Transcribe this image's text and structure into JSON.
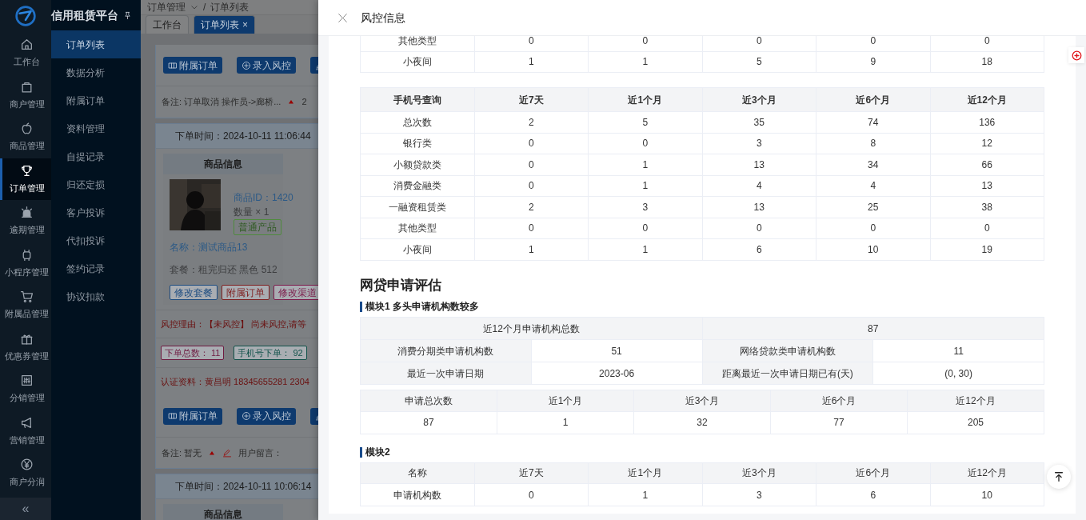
{
  "app": {
    "title": "信用租赁平台"
  },
  "rail": [
    {
      "label": "工作台",
      "selected": false
    },
    {
      "label": "商户管理",
      "selected": false
    },
    {
      "label": "商品管理",
      "selected": false
    },
    {
      "label": "订单管理",
      "selected": true
    },
    {
      "label": "逾期管理",
      "selected": false
    },
    {
      "label": "小程序管理",
      "selected": false
    },
    {
      "label": "附属品管理",
      "selected": false
    },
    {
      "label": "优惠券管理",
      "selected": false
    },
    {
      "label": "分销管理",
      "selected": false
    },
    {
      "label": "营销管理",
      "selected": false
    },
    {
      "label": "商户分润",
      "selected": false
    }
  ],
  "collapse": "«",
  "submenu": [
    {
      "label": "订单列表",
      "selected": true
    },
    {
      "label": "数据分析",
      "selected": false
    },
    {
      "label": "附属订单",
      "selected": false
    },
    {
      "label": "资料管理",
      "selected": false
    },
    {
      "label": "自提记录",
      "selected": false
    },
    {
      "label": "归还定损",
      "selected": false
    },
    {
      "label": "客户投诉",
      "selected": false
    },
    {
      "label": "代扣投诉",
      "selected": false
    },
    {
      "label": "签约记录",
      "selected": false
    },
    {
      "label": "协议扣款",
      "selected": false
    }
  ],
  "breadcrumb": [
    {
      "label": "订单管理",
      "dropdown": true
    },
    {
      "label": "订单列表",
      "dropdown": false
    }
  ],
  "breadcrumb_separator": "/",
  "tabs": [
    {
      "label": "工作台",
      "selected": false
    },
    {
      "label": "订单列表",
      "selected": true,
      "close": "×"
    }
  ],
  "order_list": {
    "top_actions": [
      {
        "kind": "grid",
        "label": "附属订单"
      },
      {
        "kind": "plus",
        "label": "录入风控"
      },
      {
        "kind": "edit"
      }
    ],
    "top_remark": {
      "text": "备注: 订单取消 操作员->廊桥...",
      "extra": "2"
    },
    "order": {
      "time": "下单时间：2024-10-11 11:06:44",
      "section": "商品信息",
      "product_id": "商品ID：1420",
      "quantity": "数量 × 1",
      "tag": "普通产品",
      "name": "名称：测试商品13",
      "package": "套餐：租完归还 黑色 512",
      "product_actions": [
        {
          "label": "修改套餐",
          "color": "#1d4c80"
        },
        {
          "label": "附属订单",
          "color": "#7e1f1f"
        },
        {
          "label": "修改渠道",
          "color": "#7c1a4a"
        }
      ],
      "risk": "风控理由：【未风控】 尚未风控,请等",
      "stats": [
        {
          "label": "下单总数：",
          "value": "11",
          "color": "#6e1a40"
        },
        {
          "label": "手机号下单：",
          "value": "92",
          "color": "#11524a"
        }
      ],
      "auth": "认证资料：黄昌明  18345655281  2304",
      "actions": [
        {
          "kind": "grid",
          "label": "附属订单"
        },
        {
          "kind": "plus",
          "label": "录入风控"
        },
        {
          "kind": "edit"
        }
      ],
      "remark": "备注: 暂无",
      "message_label": "用户留言："
    },
    "next_order": {
      "time": "下单时间：2024-10-11 10:06:14",
      "section": "商品信息"
    }
  },
  "drawer": {
    "title": "风控信息",
    "prev_table": {
      "rows": [
        [
          "其他类型",
          "0",
          "0",
          "0",
          "0",
          "0"
        ],
        [
          "小夜间",
          "1",
          "1",
          "5",
          "9",
          "18"
        ]
      ]
    },
    "phone_table": {
      "columns": [
        "手机号查询",
        "近7天",
        "近1个月",
        "近3个月",
        "近6个月",
        "近12个月"
      ],
      "rows": [
        [
          "总次数",
          "2",
          "5",
          "35",
          "74",
          "136"
        ],
        [
          "银行类",
          "0",
          "0",
          "3",
          "8",
          "12"
        ],
        [
          "小额贷款类",
          "0",
          "1",
          "13",
          "34",
          "66"
        ],
        [
          "消费金融类",
          "0",
          "1",
          "4",
          "4",
          "13"
        ],
        [
          "一融资租赁类",
          "2",
          "3",
          "13",
          "25",
          "38"
        ],
        [
          "其他类型",
          "0",
          "0",
          "0",
          "0",
          "0"
        ],
        [
          "小夜间",
          "1",
          "1",
          "6",
          "10",
          "19"
        ]
      ]
    },
    "section_title": "网贷申请评估",
    "module1": {
      "title": "模块1 多头申请机构数较多",
      "summary": [
        [
          {
            "label": "近12个月申请机构总数",
            "value": "87"
          }
        ],
        [
          {
            "label": "消费分期类申请机构数",
            "value": "51"
          },
          {
            "label": "网络贷款类申请机构数",
            "value": "11"
          }
        ],
        [
          {
            "label": "最近一次申请日期",
            "value": "2023-06"
          },
          {
            "label": "距离最近一次申请日期已有(天)",
            "value": "(0, 30)"
          }
        ]
      ],
      "counts": {
        "columns": [
          "申请总次数",
          "近1个月",
          "近3个月",
          "近6个月",
          "近12个月"
        ],
        "rows": [
          [
            "87",
            "1",
            "32",
            "77",
            "205"
          ]
        ]
      }
    },
    "module2": {
      "title": "模块2",
      "columns": [
        "名称",
        "近7天",
        "近1个月",
        "近3个月",
        "近6个月",
        "近12个月"
      ],
      "rows": [
        [
          "申请机构数",
          "0",
          "1",
          "3",
          "6",
          "10"
        ]
      ]
    }
  }
}
